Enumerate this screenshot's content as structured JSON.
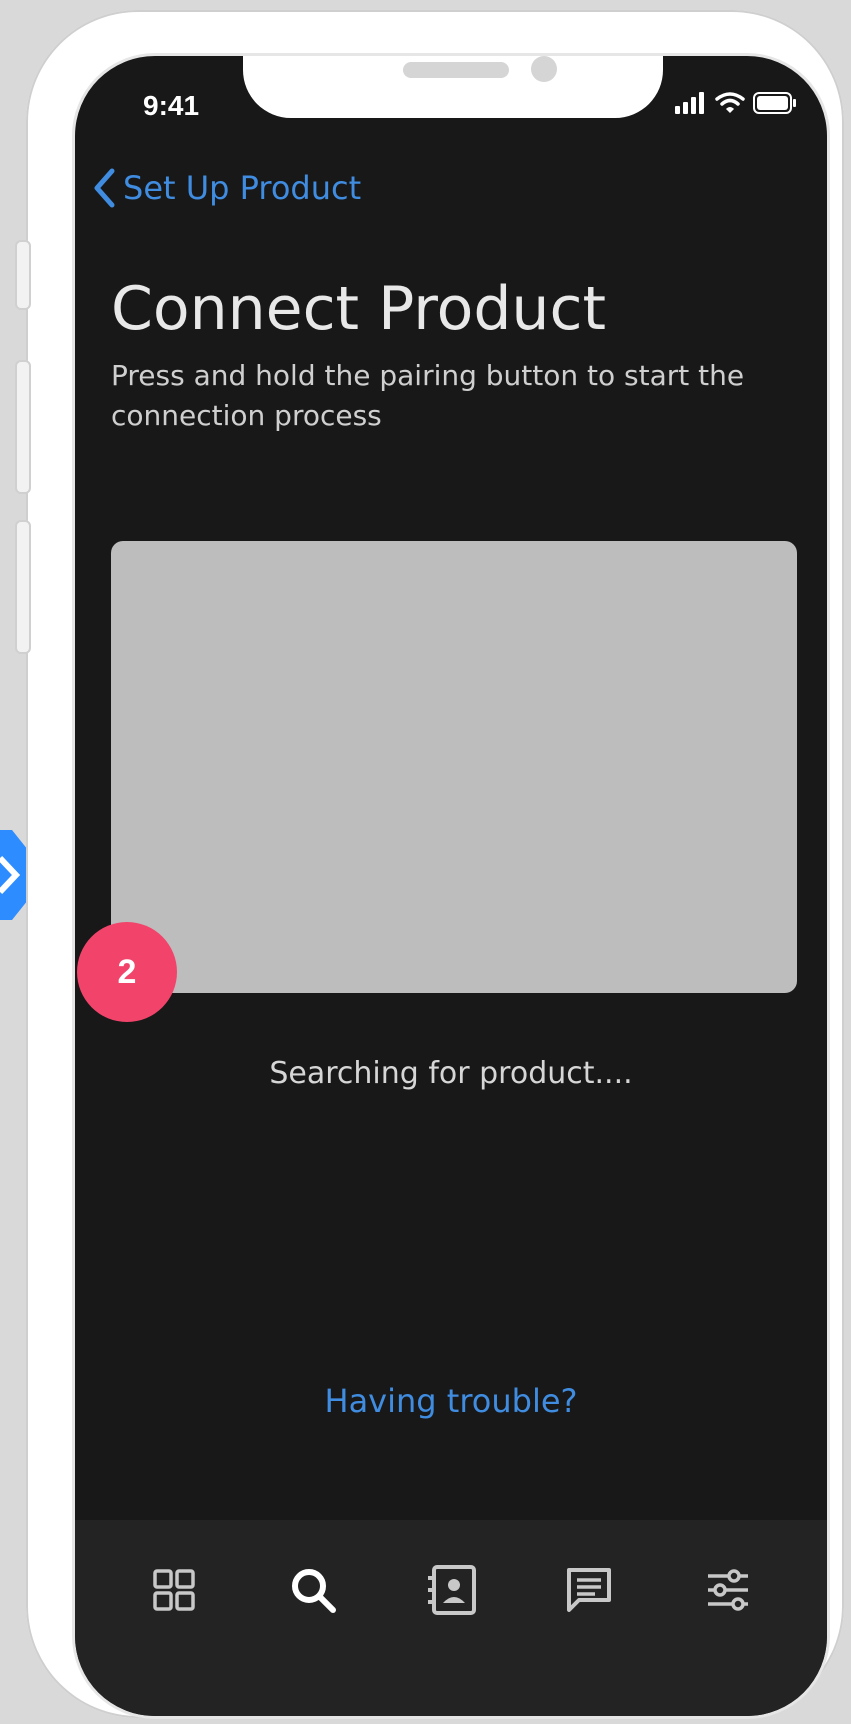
{
  "status_bar": {
    "time": "9:41"
  },
  "nav": {
    "back_label": "Set Up Product"
  },
  "content": {
    "title": "Connect Product",
    "subtitle": "Press and hold the pairing button to start the connection process",
    "status_text": "Searching for product....",
    "help_link": "Having trouble?"
  },
  "annotation": {
    "step_number": "2"
  },
  "tab_bar": {
    "tabs": [
      {
        "icon": "grid-icon"
      },
      {
        "icon": "search-icon"
      },
      {
        "icon": "contacts-icon"
      },
      {
        "icon": "message-icon"
      },
      {
        "icon": "sliders-icon"
      }
    ]
  },
  "colors": {
    "screen_background": "#181818",
    "accent_blue": "#3f8ce0",
    "badge_pink": "#f2446a",
    "placeholder_gray": "#bdbdbd",
    "tab_bar_background": "#232323"
  }
}
